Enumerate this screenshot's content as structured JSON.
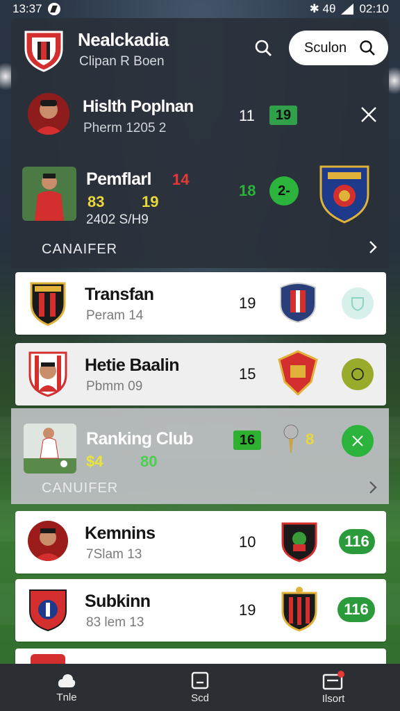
{
  "status_bar": {
    "time": "13:37",
    "right_text": "✱ 4θ",
    "battery": "02:10"
  },
  "header": {
    "title": "Nealckadia",
    "subtitle": "Clipan  R Boen"
  },
  "search": {
    "label": "Sculon"
  },
  "hero": {
    "row1": {
      "name": "Hislth Poplnan",
      "sub": "Pherm  1205 2",
      "number": "11",
      "badge": "19"
    },
    "row2": {
      "name": "Pemflarl",
      "red_number": "14",
      "yellow_a": "83",
      "yellow_b": "19",
      "sub": "2402 S/H9",
      "green_number": "18",
      "circle": "2-"
    },
    "transfer_label": "CANAIFER"
  },
  "cards": [
    {
      "name": "Transfan",
      "sub": "Peram 14",
      "number": "19"
    },
    {
      "name": "Hetie Baalin",
      "sub": "Pbmm 09",
      "number": "15"
    },
    {
      "name": "Kemnins",
      "sub": "7Slam 13",
      "number": "10",
      "pill": "116"
    },
    {
      "name": "Subkinn",
      "sub": "83 lem 13",
      "number": "19",
      "pill": "116"
    }
  ],
  "ranking": {
    "name": "Ranking Club",
    "badge": "16",
    "yellow": "8",
    "stat_a": "$4",
    "stat_b": "80",
    "transfer_label": "CANUIFER"
  },
  "bottom_nav": [
    {
      "label": "Tnle",
      "icon": "cloud-icon"
    },
    {
      "label": "Scd",
      "icon": "tablet-icon"
    },
    {
      "label": "Ilsort",
      "icon": "inbox-icon"
    }
  ],
  "colors": {
    "accent_green": "#2bb33c",
    "red": "#e53935",
    "yellow": "#e8d83a"
  }
}
